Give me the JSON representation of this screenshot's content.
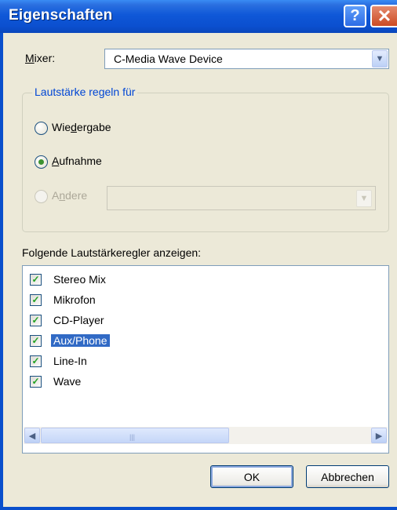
{
  "window": {
    "title": "Eigenschaften"
  },
  "titlebar": {
    "help_glyph": "?",
    "close_glyph": "✕"
  },
  "mixer": {
    "label_first": "M",
    "label_rest": "ixer:",
    "selected": "C-Media Wave Device"
  },
  "group": {
    "title": "Lautstärke regeln für",
    "options": [
      {
        "before": "Wie",
        "accel": "d",
        "after": "ergabe",
        "checked": false,
        "enabled": true
      },
      {
        "before": "",
        "accel": "A",
        "after": "ufnahme",
        "checked": true,
        "enabled": true
      },
      {
        "before": "A",
        "accel": "n",
        "after": "dere",
        "checked": false,
        "enabled": false
      }
    ],
    "other_value": ""
  },
  "list": {
    "label": "Folgende Lautstärkeregler anzeigen:",
    "items": [
      {
        "label": "Stereo Mix",
        "checked": true,
        "selected": false
      },
      {
        "label": "Mikrofon",
        "checked": true,
        "selected": false
      },
      {
        "label": "CD-Player",
        "checked": true,
        "selected": false
      },
      {
        "label": "Aux/Phone",
        "checked": true,
        "selected": true
      },
      {
        "label": "Line-In",
        "checked": true,
        "selected": false
      },
      {
        "label": "Wave",
        "checked": true,
        "selected": false
      }
    ]
  },
  "buttons": {
    "ok": "OK",
    "cancel": "Abbrechen"
  },
  "icons": {
    "dropdown": "chevron-down-icon",
    "scroll_left": "chevron-left-icon",
    "scroll_right": "chevron-right-icon",
    "check": "checkmark-icon",
    "scroll_left_glyph": "◀",
    "scroll_right_glyph": "▶",
    "dropdown_glyph": "▼",
    "check_glyph": "✓",
    "grip_glyph": "|||"
  },
  "colors": {
    "title_bar": "#0b4fcf",
    "group_title": "#0046d5",
    "selection": "#316ac5",
    "check": "#21a121"
  }
}
